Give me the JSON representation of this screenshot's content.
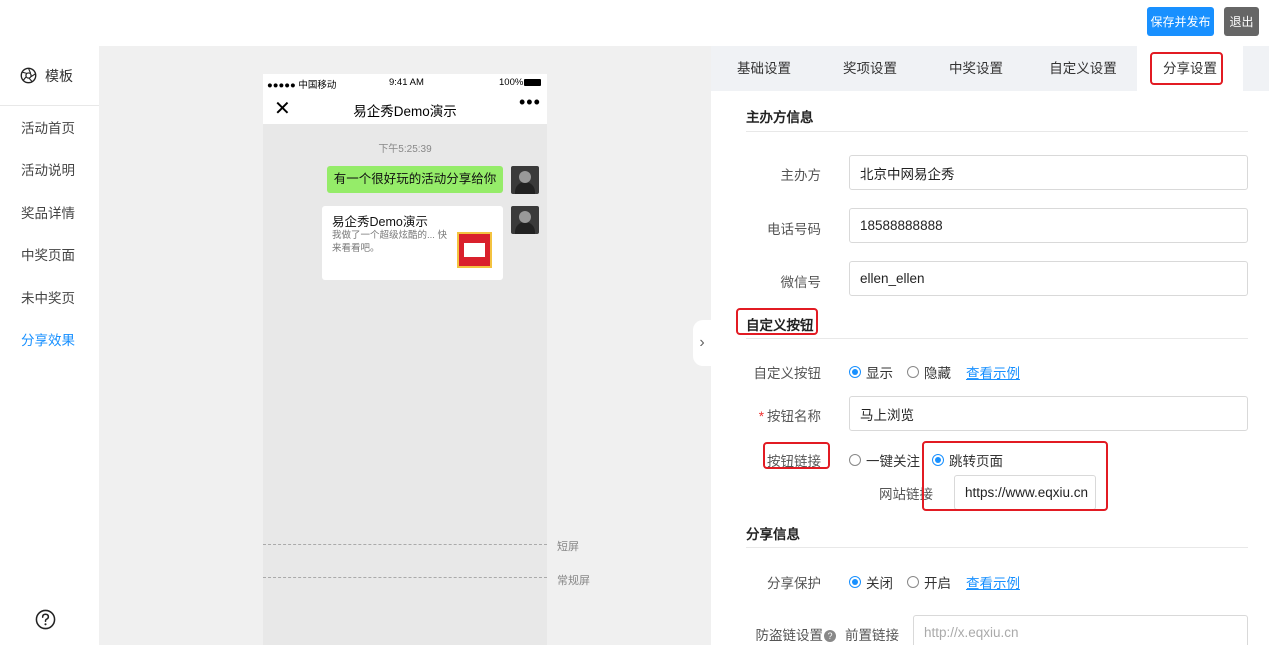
{
  "topbar": {
    "publish_label": "保存并发布",
    "exit_label": "退出"
  },
  "sidebar": {
    "header": "模板",
    "items": [
      {
        "label": "活动首页",
        "active": false
      },
      {
        "label": "活动说明",
        "active": false
      },
      {
        "label": "奖品详情",
        "active": false
      },
      {
        "label": "中奖页面",
        "active": false
      },
      {
        "label": "未中奖页",
        "active": false
      },
      {
        "label": "分享效果",
        "active": true
      }
    ]
  },
  "phone": {
    "carrier": "●●●●● 中国移动",
    "time": "9:41 AM",
    "battery": "100%",
    "title": "易企秀Demo演示",
    "chat_time": "下午5:25:39",
    "message": "有一个很好玩的活动分享给你",
    "card_title": "易企秀Demo演示",
    "card_desc": "我做了一个超级炫酷的... 快来看看吧。",
    "short_screen": "短屏",
    "normal_screen": "常规屏"
  },
  "tabs": [
    {
      "label": "基础设置",
      "active": false
    },
    {
      "label": "奖项设置",
      "active": false
    },
    {
      "label": "中奖设置",
      "active": false
    },
    {
      "label": "自定义设置",
      "active": false
    },
    {
      "label": "分享设置",
      "active": true
    }
  ],
  "host": {
    "title": "主办方信息",
    "org_label": "主办方",
    "org_value": "北京中网易企秀",
    "phone_label": "电话号码",
    "phone_value": "18588888888",
    "wechat_label": "微信号",
    "wechat_value": "ellen_ellen"
  },
  "custom_button": {
    "title": "自定义按钮",
    "toggle_label": "自定义按钮",
    "show_label": "显示",
    "hide_label": "隐藏",
    "example_link": "查看示例",
    "name_label": "按钮名称",
    "name_value": "马上浏览",
    "link_label": "按钮链接",
    "follow_label": "一键关注",
    "jump_label": "跳转页面",
    "url_label": "网站链接",
    "url_value": "https://www.eqxiu.cn"
  },
  "share": {
    "title": "分享信息",
    "protect_label": "分享保护",
    "off_label": "关闭",
    "on_label": "开启",
    "example_link": "查看示例",
    "anti_leech_label": "防盗链设置",
    "prefix_label": "前置链接",
    "prefix_placeholder": "http://x.eqxiu.cn"
  },
  "colors": {
    "accent": "#1890ff",
    "highlight": "#e21b23",
    "bubble": "#95ec69"
  }
}
